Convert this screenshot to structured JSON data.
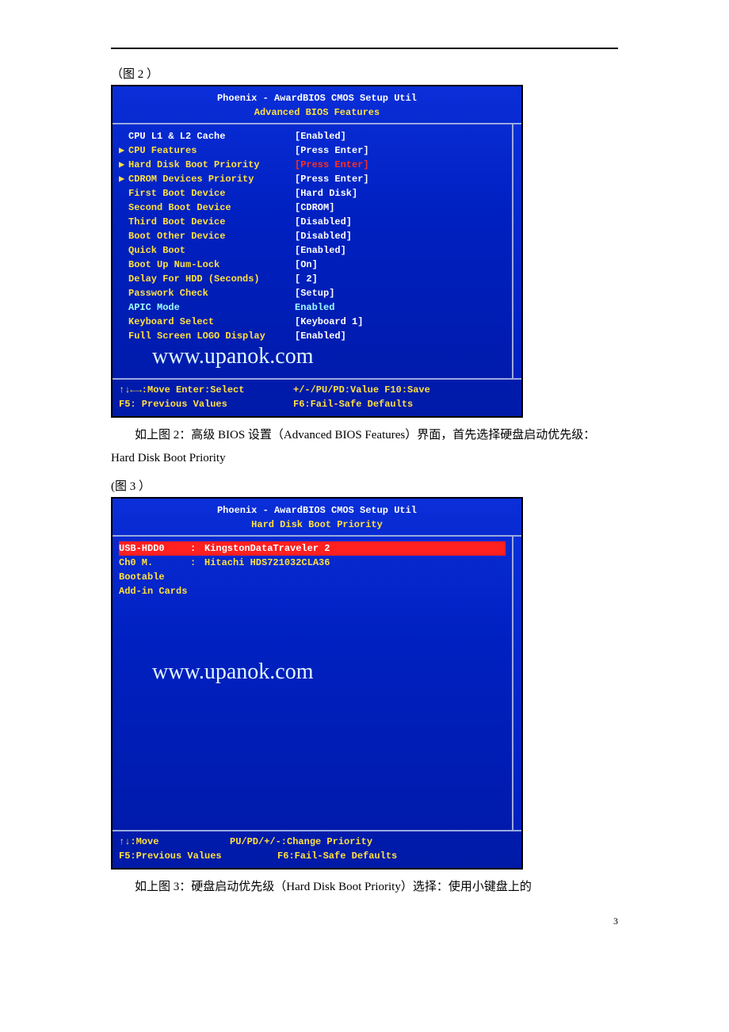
{
  "caption2": "（图 2 ）",
  "caption3": "(图 3 ）",
  "pageNumber": "3",
  "bios2": {
    "title1": "Phoenix - AwardBIOS CMOS Setup Util",
    "title2": "Advanced BIOS Features",
    "watermark": "www.upanok.com",
    "rows": [
      {
        "marker": "",
        "label": "CPU L1 & L2 Cache",
        "value": "[Enabled]",
        "hl": false,
        "valRed": false
      },
      {
        "marker": "▶",
        "label": "CPU Features",
        "value": "[Press Enter]",
        "hl": true,
        "valRed": false
      },
      {
        "marker": "▶",
        "label": "Hard Disk Boot Priority",
        "value": "[Press Enter]",
        "hl": true,
        "valRed": true
      },
      {
        "marker": "▶",
        "label": "CDROM Devices Priority",
        "value": "[Press Enter]",
        "hl": true,
        "valRed": false
      },
      {
        "marker": "",
        "label": "First Boot Device",
        "value": "[Hard Disk]",
        "hl": true,
        "valRed": false
      },
      {
        "marker": "",
        "label": "Second Boot Device",
        "value": "[CDROM]",
        "hl": true,
        "valRed": false
      },
      {
        "marker": "",
        "label": "Third Boot Device",
        "value": "[Disabled]",
        "hl": true,
        "valRed": false
      },
      {
        "marker": "",
        "label": "Boot Other Device",
        "value": "[Disabled]",
        "hl": true,
        "valRed": false
      },
      {
        "marker": "",
        "label": "Quick Boot",
        "value": "[Enabled]",
        "hl": true,
        "valRed": false
      },
      {
        "marker": "",
        "label": "Boot Up Num-Lock",
        "value": "[On]",
        "hl": true,
        "valRed": false
      },
      {
        "marker": "",
        "label": "Delay For HDD (Seconds)",
        "value": "[ 2]",
        "hl": true,
        "valRed": false
      },
      {
        "marker": "",
        "label": "Passwork Check",
        "value": "[Setup]",
        "hl": true,
        "valRed": false
      },
      {
        "marker": "",
        "label": "APIC Mode",
        "value": " Enabled",
        "hl": false,
        "valRed": false,
        "dim": true
      },
      {
        "marker": "",
        "label": "Keyboard Select",
        "value": "[Keyboard 1]",
        "hl": true,
        "valRed": false
      },
      {
        "marker": "",
        "label": "Full Screen LOGO Display",
        "value": "[Enabled]",
        "hl": true,
        "valRed": false
      }
    ],
    "footer1_left": "↑↓←→:Move  Enter:Select",
    "footer1_right": "+/-/PU/PD:Value  F10:Save",
    "footer2_left": "F5: Previous Values",
    "footer2_right": "F6:Fail-Safe Defaults"
  },
  "text2": "如上图 2：高级 BIOS 设置（Advanced BIOS Features）界面，首先选择硬盘启动优先级：Hard Disk Boot Priority",
  "bios3": {
    "title1": "Phoenix - AwardBIOS CMOS Setup Util",
    "title2": "Hard Disk Boot Priority",
    "watermark": "www.upanok.com",
    "items": [
      {
        "left": "USB-HDD0",
        "sep": ":",
        "right": "KingstonDataTraveler 2",
        "sel": true
      },
      {
        "left": "Ch0 M.",
        "sep": ":",
        "right": "Hitachi HDS721032CLA36",
        "sel": false
      },
      {
        "left": "Bootable Add-in Cards",
        "sep": "",
        "right": "",
        "sel": false
      }
    ],
    "footer1_left": "↑↓:Move",
    "footer1_right": "PU/PD/+/-:Change Priority",
    "footer2_left": "F5:Previous Values",
    "footer2_right": "F6:Fail-Safe Defaults"
  },
  "text3": "如上图 3：硬盘启动优先级（Hard Disk Boot Priority）选择：使用小键盘上的"
}
